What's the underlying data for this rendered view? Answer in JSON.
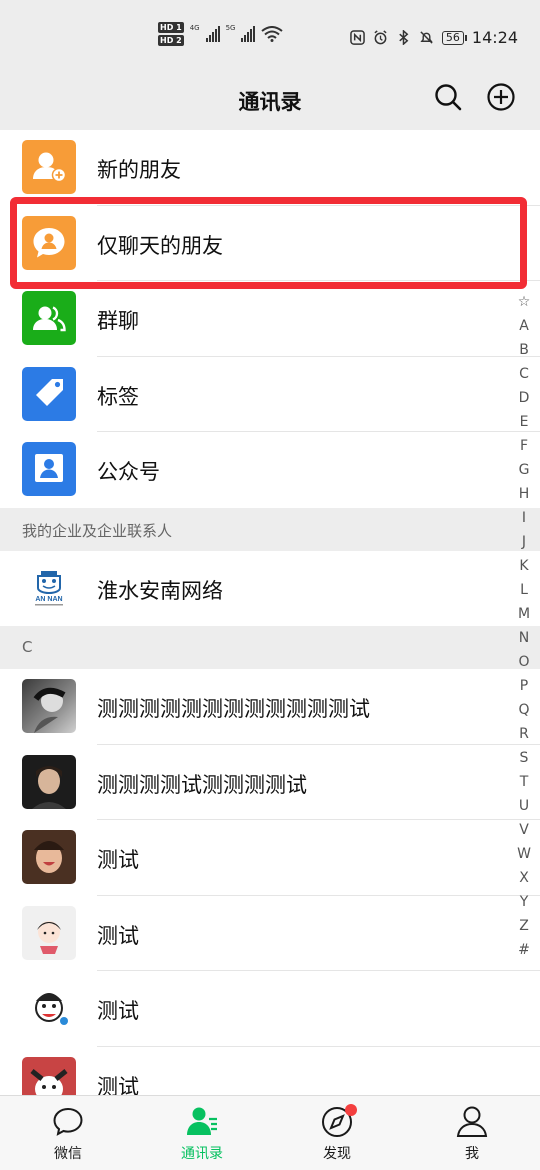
{
  "status_bar": {
    "hd1": "HD 1",
    "hd2": "HD 2",
    "net1": "4G",
    "net2": "5G",
    "battery": "56",
    "time": "14:24"
  },
  "header": {
    "title": "通讯录"
  },
  "top_items": [
    {
      "label": "新的朋友",
      "color": "#f79c38"
    },
    {
      "label": "仅聊天的朋友",
      "color": "#f79c38"
    },
    {
      "label": "群聊",
      "color": "#1aad19"
    },
    {
      "label": "标签",
      "color": "#2c7be5"
    },
    {
      "label": "公众号",
      "color": "#2c7be5"
    }
  ],
  "enterprise": {
    "section_title": "我的企业及企业联系人",
    "item_label": "淮水安南网络",
    "logo_text": "AN NAN"
  },
  "section_c": {
    "title": "C",
    "contacts": [
      {
        "label": "测测测测测测测测测测测测试"
      },
      {
        "label": "测测测测试测测测测试"
      },
      {
        "label": "测试"
      },
      {
        "label": "测试"
      },
      {
        "label": "测试"
      },
      {
        "label": "测试"
      }
    ]
  },
  "index_letters": [
    "☆",
    "A",
    "B",
    "C",
    "D",
    "E",
    "F",
    "G",
    "H",
    "I",
    "J",
    "K",
    "L",
    "M",
    "N",
    "O",
    "P",
    "Q",
    "R",
    "S",
    "T",
    "U",
    "V",
    "W",
    "X",
    "Y",
    "Z",
    "#"
  ],
  "tabs": [
    {
      "label": "微信",
      "icon": "chat-icon",
      "active": false
    },
    {
      "label": "通讯录",
      "icon": "contacts-icon",
      "active": true
    },
    {
      "label": "发现",
      "icon": "compass-icon",
      "active": false,
      "badge": true
    },
    {
      "label": "我",
      "icon": "person-icon",
      "active": false
    }
  ],
  "colors": {
    "accent": "#07c160",
    "highlight_border": "#f22d35",
    "badge": "#f43f3f"
  }
}
